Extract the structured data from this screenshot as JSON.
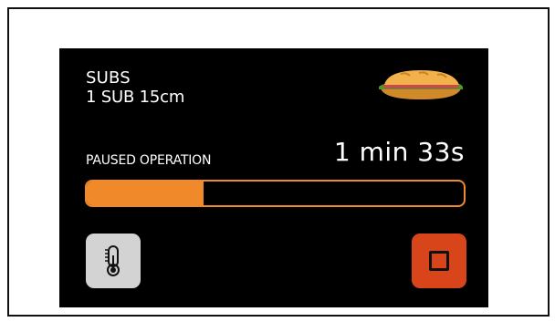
{
  "product": {
    "category": "SUBS",
    "item": "1 SUB 15cm"
  },
  "operation": {
    "status": "PAUSED OPERATION",
    "remaining": "1 min 33s",
    "progress_fraction": 0.31
  },
  "icons": {
    "product": "sandwich-icon",
    "temperature": "thermometer-icon",
    "stop": "stop-icon"
  },
  "colors": {
    "accent": "#f0892a",
    "stop": "#d9451a",
    "temp_button": "#d3d3d3",
    "background": "#000000"
  }
}
